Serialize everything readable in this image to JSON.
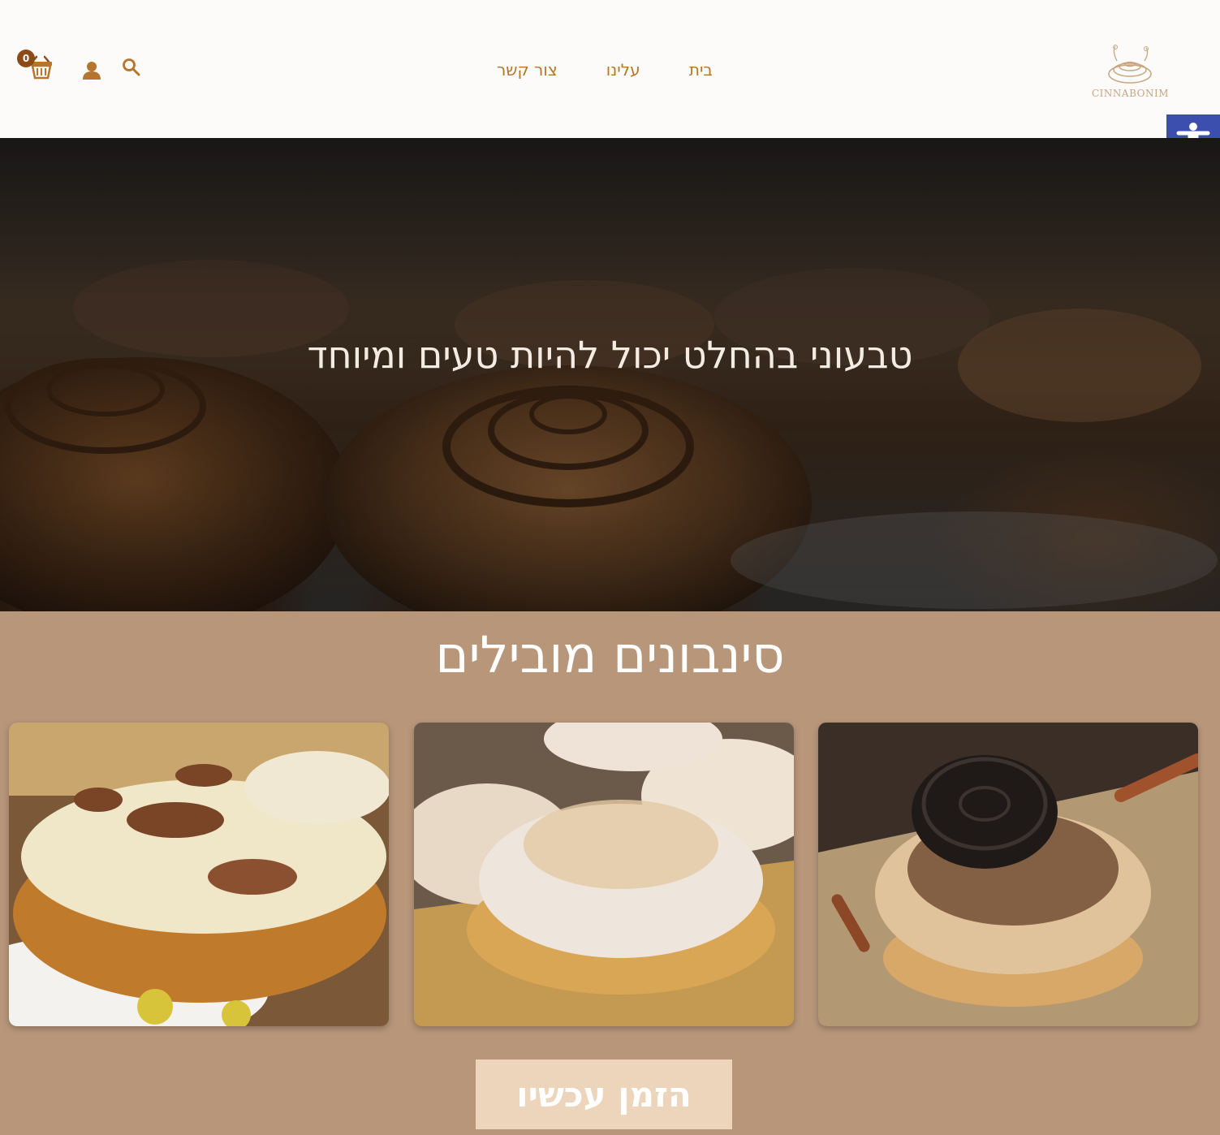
{
  "header": {
    "logo_text": "CINNABONIM",
    "nav": [
      {
        "label": "בית"
      },
      {
        "label": "עלינו"
      },
      {
        "label": "צור קשר"
      }
    ],
    "cart_count": "0",
    "icons": [
      "search-icon",
      "user-icon",
      "cart-icon"
    ]
  },
  "hero": {
    "title": "טבעוני בהחלט יכול להיות טעים ומיוחד"
  },
  "featured": {
    "title": "סינבונים מובילים",
    "products": [
      {
        "image": "pecan-cinnamon-bun"
      },
      {
        "image": "nut-frosted-cinnamon-bun"
      },
      {
        "image": "oreo-cinnamon-bun"
      }
    ]
  },
  "cta": {
    "label": "הזמן עכשיו"
  },
  "colors": {
    "accent": "#b5752c",
    "header_bg": "#fdfbf9",
    "section_bg": "#b8967a",
    "button_bg": "#ecd5bb",
    "accessibility_bg": "#3c4fae"
  }
}
